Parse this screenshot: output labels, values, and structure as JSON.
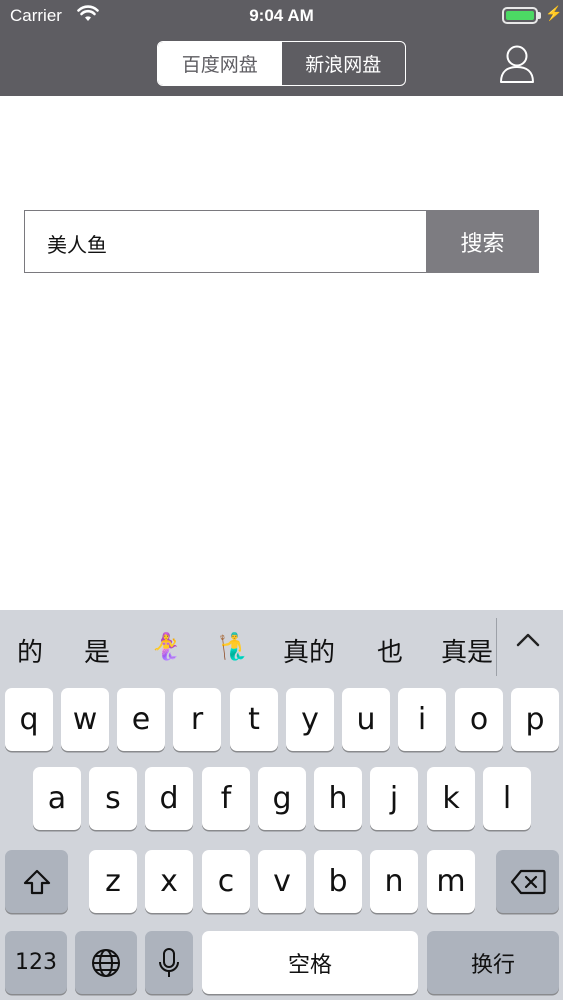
{
  "status_bar": {
    "carrier": "Carrier",
    "time": "9:04 AM"
  },
  "header": {
    "tabs": [
      {
        "label": "百度网盘"
      },
      {
        "label": "新浪网盘"
      }
    ]
  },
  "search": {
    "value": "美人鱼",
    "button_label": "搜索"
  },
  "keyboard": {
    "candidates": [
      "的",
      "是",
      "🧜‍♀️",
      "🧜‍♂️",
      "真的",
      "也",
      "真是"
    ],
    "row1": [
      "q",
      "w",
      "e",
      "r",
      "t",
      "y",
      "u",
      "i",
      "o",
      "p"
    ],
    "row2": [
      "a",
      "s",
      "d",
      "f",
      "g",
      "h",
      "j",
      "k",
      "l"
    ],
    "row3": [
      "z",
      "x",
      "c",
      "v",
      "b",
      "n",
      "m"
    ],
    "numbers_label": "123",
    "space_label": "空格",
    "return_label": "换行"
  },
  "colors": {
    "header": "#5e5d62",
    "accent": "#7d7c81",
    "keyboard_bg": "#d1d4da",
    "battery": "#4cd964"
  }
}
